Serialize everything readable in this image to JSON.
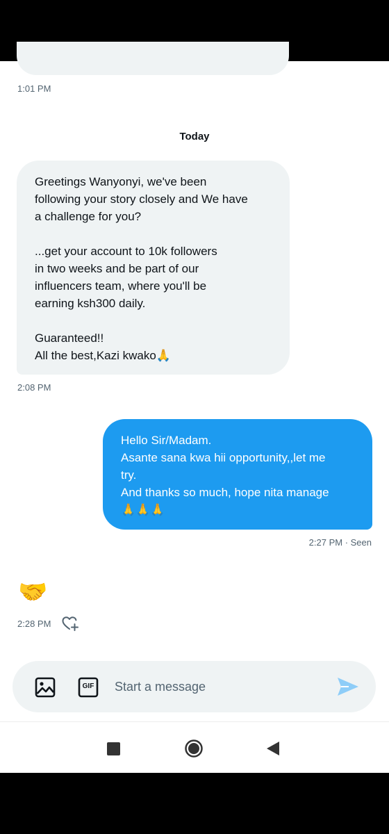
{
  "conversation": {
    "previous_time": "1:01 PM",
    "day_separator": "Today",
    "messages": [
      {
        "direction": "incoming",
        "paragraphs": [
          "Greetings Wanyonyi, we've been\nfollowing your story closely and We have\na challenge for you?",
          "...get your account to 10k followers\nin two weeks and be part of our\ninfluencers team, where you'll be\nearning ksh300 daily.",
          "Guaranteed!!\nAll the best,Kazi kwako🙏"
        ],
        "time": "2:08 PM"
      },
      {
        "direction": "outgoing",
        "text": "Hello Sir/Madam.\nAsante sana kwa hii opportunity,,let me\ntry.\nAnd thanks so much, hope nita manage\n🙏🙏🙏",
        "time": "2:27 PM · Seen"
      },
      {
        "direction": "incoming",
        "emoji": "🤝",
        "time": "2:28 PM"
      }
    ]
  },
  "composer": {
    "placeholder": "Start a message",
    "gif_label": "GIF",
    "icons": [
      "image-icon",
      "gif-icon",
      "send-icon"
    ]
  },
  "system_nav": {
    "icons": [
      "recent-apps-icon",
      "home-icon",
      "back-icon"
    ]
  },
  "colors": {
    "accent": "#1d9bf0",
    "incoming_bubble": "#eff3f4",
    "secondary_text": "#536471"
  }
}
